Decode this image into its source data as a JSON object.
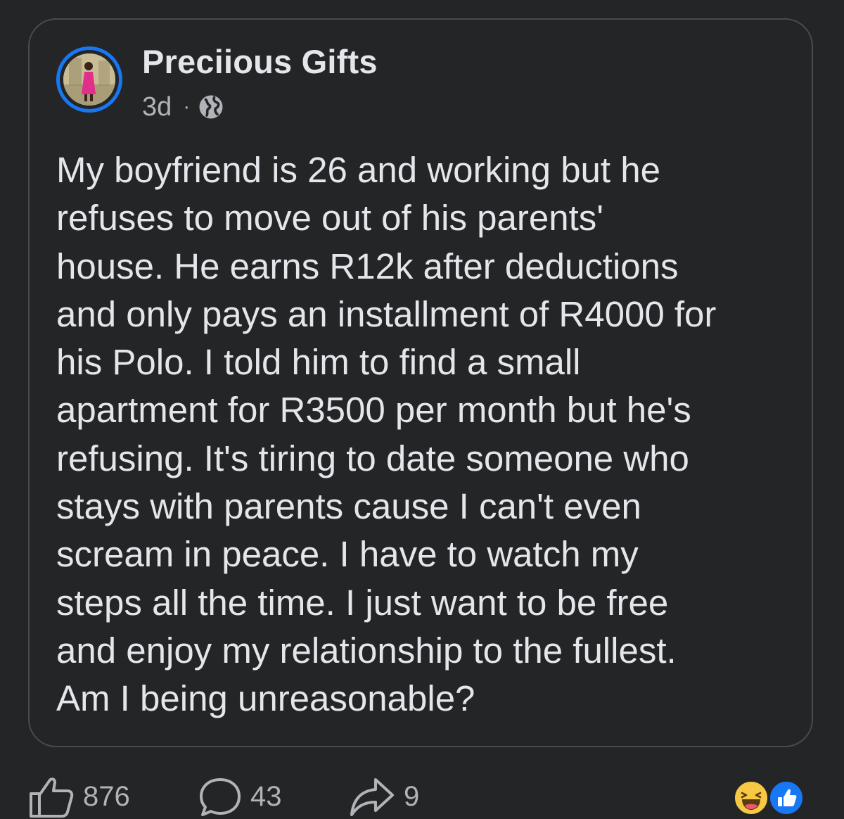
{
  "post": {
    "author_name": "Preciious Gifts",
    "timestamp": "3d",
    "separator": "·",
    "privacy_icon": "globe-icon",
    "body": "My boyfriend is 26 and working but he\nrefuses to move out of his parents'\nhouse. He earns R12k after deductions\nand only pays an installment of R4000 for\nhis Polo. I told him to find a small\napartment for R3500 per month but he's\nrefusing. It's tiring to date someone who\nstays with parents cause I can't even\nscream in peace. I have to watch my\nsteps all the time. I just want to be free\nand enjoy my relationship to the fullest.\nAm I being unreasonable?"
  },
  "actions": {
    "like": {
      "icon": "thumbs-up-icon",
      "count": "876"
    },
    "comment": {
      "icon": "comment-bubble-icon",
      "count": "43"
    },
    "share": {
      "icon": "share-arrow-icon",
      "count": "9"
    }
  },
  "reactions": [
    "haha-reaction-icon",
    "like-reaction-icon"
  ],
  "colors": {
    "background": "#242526",
    "card_border": "#4a4b4d",
    "avatar_ring": "#1877f2",
    "primary_text": "#e4e6eb",
    "secondary_text": "#b0b3b8",
    "like_blue": "#1877f2",
    "haha_yellow": "#f7c844"
  }
}
